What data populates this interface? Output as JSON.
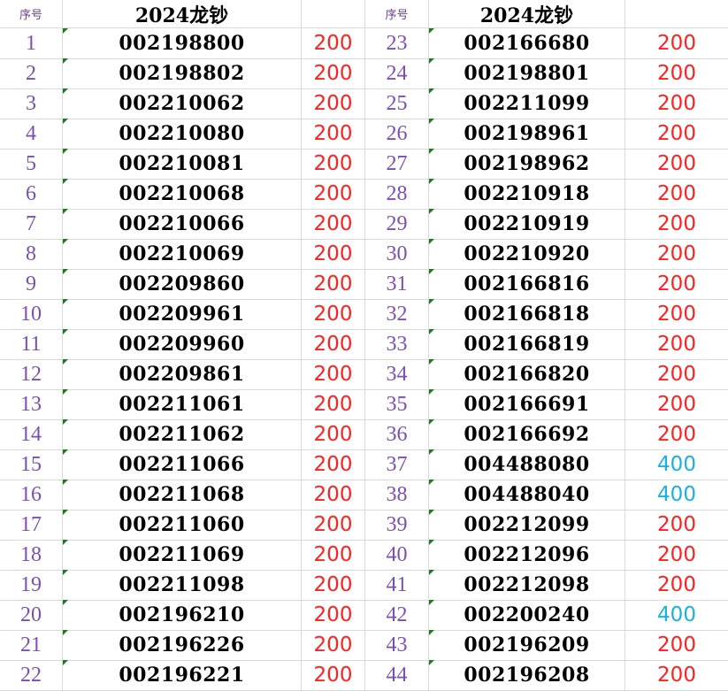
{
  "header": {
    "seq_label_left": "序号",
    "title_left": "2024龙钞",
    "seq_label_right": "序号",
    "title_right": "2024龙钞"
  },
  "colors": {
    "amount_200": "#ff2020",
    "amount_400": "#1ab0e0",
    "seq_text": "#7a4fb5",
    "gridline": "#d9d9d9",
    "cell_marker": "#1f7a1f"
  },
  "rows": [
    {
      "left": {
        "seq": "1",
        "serial": "002198800",
        "amount": "200"
      },
      "right": {
        "seq": "23",
        "serial": "002166680",
        "amount": "200"
      }
    },
    {
      "left": {
        "seq": "2",
        "serial": "002198802",
        "amount": "200"
      },
      "right": {
        "seq": "24",
        "serial": "002198801",
        "amount": "200"
      }
    },
    {
      "left": {
        "seq": "3",
        "serial": "002210062",
        "amount": "200"
      },
      "right": {
        "seq": "25",
        "serial": "002211099",
        "amount": "200"
      }
    },
    {
      "left": {
        "seq": "4",
        "serial": "002210080",
        "amount": "200"
      },
      "right": {
        "seq": "26",
        "serial": "002198961",
        "amount": "200"
      }
    },
    {
      "left": {
        "seq": "5",
        "serial": "002210081",
        "amount": "200"
      },
      "right": {
        "seq": "27",
        "serial": "002198962",
        "amount": "200"
      }
    },
    {
      "left": {
        "seq": "6",
        "serial": "002210068",
        "amount": "200"
      },
      "right": {
        "seq": "28",
        "serial": "002210918",
        "amount": "200"
      }
    },
    {
      "left": {
        "seq": "7",
        "serial": "002210066",
        "amount": "200"
      },
      "right": {
        "seq": "29",
        "serial": "002210919",
        "amount": "200"
      }
    },
    {
      "left": {
        "seq": "8",
        "serial": "002210069",
        "amount": "200"
      },
      "right": {
        "seq": "30",
        "serial": "002210920",
        "amount": "200"
      }
    },
    {
      "left": {
        "seq": "9",
        "serial": "002209860",
        "amount": "200"
      },
      "right": {
        "seq": "31",
        "serial": "002166816",
        "amount": "200"
      }
    },
    {
      "left": {
        "seq": "10",
        "serial": "002209961",
        "amount": "200"
      },
      "right": {
        "seq": "32",
        "serial": "002166818",
        "amount": "200"
      }
    },
    {
      "left": {
        "seq": "11",
        "serial": "002209960",
        "amount": "200"
      },
      "right": {
        "seq": "33",
        "serial": "002166819",
        "amount": "200"
      }
    },
    {
      "left": {
        "seq": "12",
        "serial": "002209861",
        "amount": "200"
      },
      "right": {
        "seq": "34",
        "serial": "002166820",
        "amount": "200"
      }
    },
    {
      "left": {
        "seq": "13",
        "serial": "002211061",
        "amount": "200"
      },
      "right": {
        "seq": "35",
        "serial": "002166691",
        "amount": "200"
      }
    },
    {
      "left": {
        "seq": "14",
        "serial": "002211062",
        "amount": "200"
      },
      "right": {
        "seq": "36",
        "serial": "002166692",
        "amount": "200"
      }
    },
    {
      "left": {
        "seq": "15",
        "serial": "002211066",
        "amount": "200"
      },
      "right": {
        "seq": "37",
        "serial": "004488080",
        "amount": "400"
      }
    },
    {
      "left": {
        "seq": "16",
        "serial": "002211068",
        "amount": "200"
      },
      "right": {
        "seq": "38",
        "serial": "004488040",
        "amount": "400"
      }
    },
    {
      "left": {
        "seq": "17",
        "serial": "002211060",
        "amount": "200"
      },
      "right": {
        "seq": "39",
        "serial": "002212099",
        "amount": "200"
      }
    },
    {
      "left": {
        "seq": "18",
        "serial": "002211069",
        "amount": "200"
      },
      "right": {
        "seq": "40",
        "serial": "002212096",
        "amount": "200"
      }
    },
    {
      "left": {
        "seq": "19",
        "serial": "002211098",
        "amount": "200"
      },
      "right": {
        "seq": "41",
        "serial": "002212098",
        "amount": "200"
      }
    },
    {
      "left": {
        "seq": "20",
        "serial": "002196210",
        "amount": "200"
      },
      "right": {
        "seq": "42",
        "serial": "002200240",
        "amount": "400"
      }
    },
    {
      "left": {
        "seq": "21",
        "serial": "002196226",
        "amount": "200"
      },
      "right": {
        "seq": "43",
        "serial": "002196209",
        "amount": "200"
      }
    },
    {
      "left": {
        "seq": "22",
        "serial": "002196221",
        "amount": "200"
      },
      "right": {
        "seq": "44",
        "serial": "002196208",
        "amount": "200"
      }
    }
  ]
}
